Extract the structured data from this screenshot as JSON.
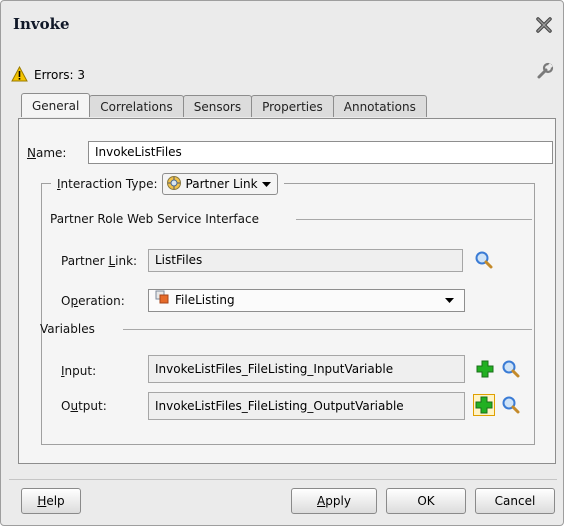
{
  "dialog": {
    "title": "Invoke",
    "errors_text": "Errors: 3"
  },
  "tabs": [
    {
      "label": "General",
      "active": true
    },
    {
      "label": "Correlations",
      "active": false
    },
    {
      "label": "Sensors",
      "active": false
    },
    {
      "label": "Properties",
      "active": false
    },
    {
      "label": "Annotations",
      "active": false
    }
  ],
  "general": {
    "name_label_mnemonic": "N",
    "name_label_rest": "ame:",
    "name_value": "InvokeListFiles",
    "interaction_label_mnemonic": "I",
    "interaction_label_rest": "nteraction Type:",
    "interaction_type": "Partner Link",
    "section_partner_role": "Partner Role Web Service Interface",
    "partner_link_label_pre": "Partner ",
    "partner_link_label_mnemonic": "L",
    "partner_link_label_rest": "ink:",
    "partner_link_value": "ListFiles",
    "operation_label_pre": "O",
    "operation_label_mnemonic": "p",
    "operation_label_rest": "eration:",
    "operation_value": "FileListing",
    "section_variables": "Variables",
    "input_label_mnemonic": "I",
    "input_label_rest": "nput:",
    "input_value": "InvokeListFiles_FileListing_InputVariable",
    "output_label_pre": "O",
    "output_label_mnemonic": "u",
    "output_label_rest": "tput:",
    "output_value": "InvokeListFiles_FileListing_OutputVariable"
  },
  "buttons": {
    "help_mnemonic": "H",
    "help_rest": "elp",
    "apply_mnemonic": "A",
    "apply_rest": "pply",
    "ok": "OK",
    "cancel": "Cancel"
  },
  "colors": {
    "add_icon": "#22b022",
    "search_icon": "#3a7bd5",
    "warning_icon": "#f5c400"
  }
}
